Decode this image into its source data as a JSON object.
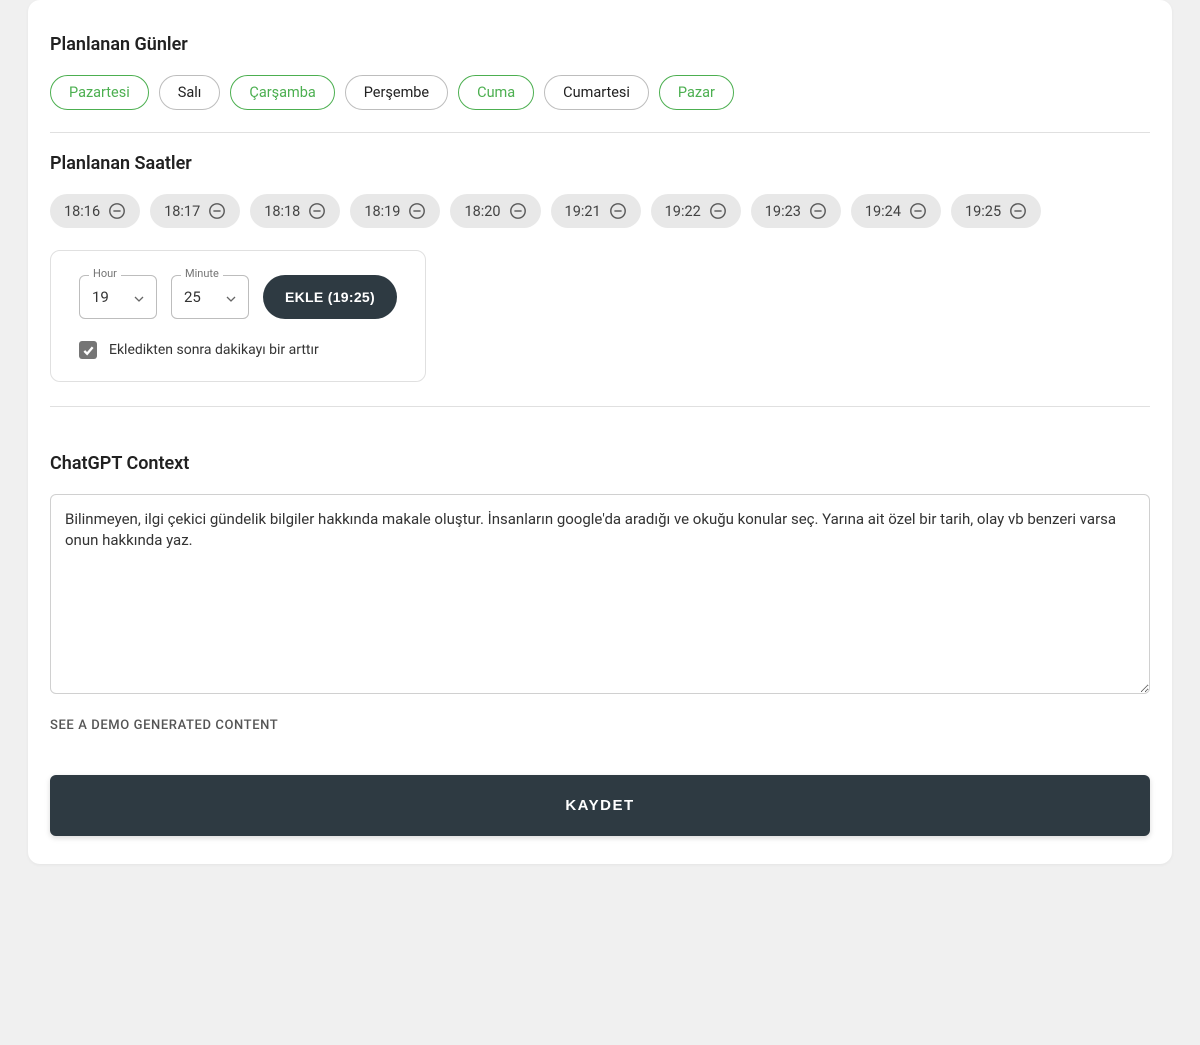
{
  "planned_days": {
    "title": "Planlanan Günler",
    "days": [
      {
        "label": "Pazartesi",
        "selected": true
      },
      {
        "label": "Salı",
        "selected": false
      },
      {
        "label": "Çarşamba",
        "selected": true
      },
      {
        "label": "Perşembe",
        "selected": false
      },
      {
        "label": "Cuma",
        "selected": true
      },
      {
        "label": "Cumartesi",
        "selected": false
      },
      {
        "label": "Pazar",
        "selected": true
      }
    ]
  },
  "planned_hours": {
    "title": "Planlanan Saatler",
    "times": [
      "18:16",
      "18:17",
      "18:18",
      "18:19",
      "18:20",
      "19:21",
      "19:22",
      "19:23",
      "19:24",
      "19:25"
    ],
    "hour_label": "Hour",
    "minute_label": "Minute",
    "hour_value": "19",
    "minute_value": "25",
    "add_button": "EKLE (19:25)",
    "increment_checkbox_label": "Ekledikten sonra dakikayı bir arttır",
    "increment_checked": true
  },
  "chatgpt": {
    "title": "ChatGPT Context",
    "content": "Bilinmeyen, ilgi çekici gündelik bilgiler hakkında makale oluştur. İnsanların google'da aradığı ve okuğu konular seç. Yarına ait özel bir tarih, olay vb benzeri varsa onun hakkında yaz.",
    "demo_link": "SEE A DEMO GENERATED CONTENT"
  },
  "save_button": "KAYDET"
}
